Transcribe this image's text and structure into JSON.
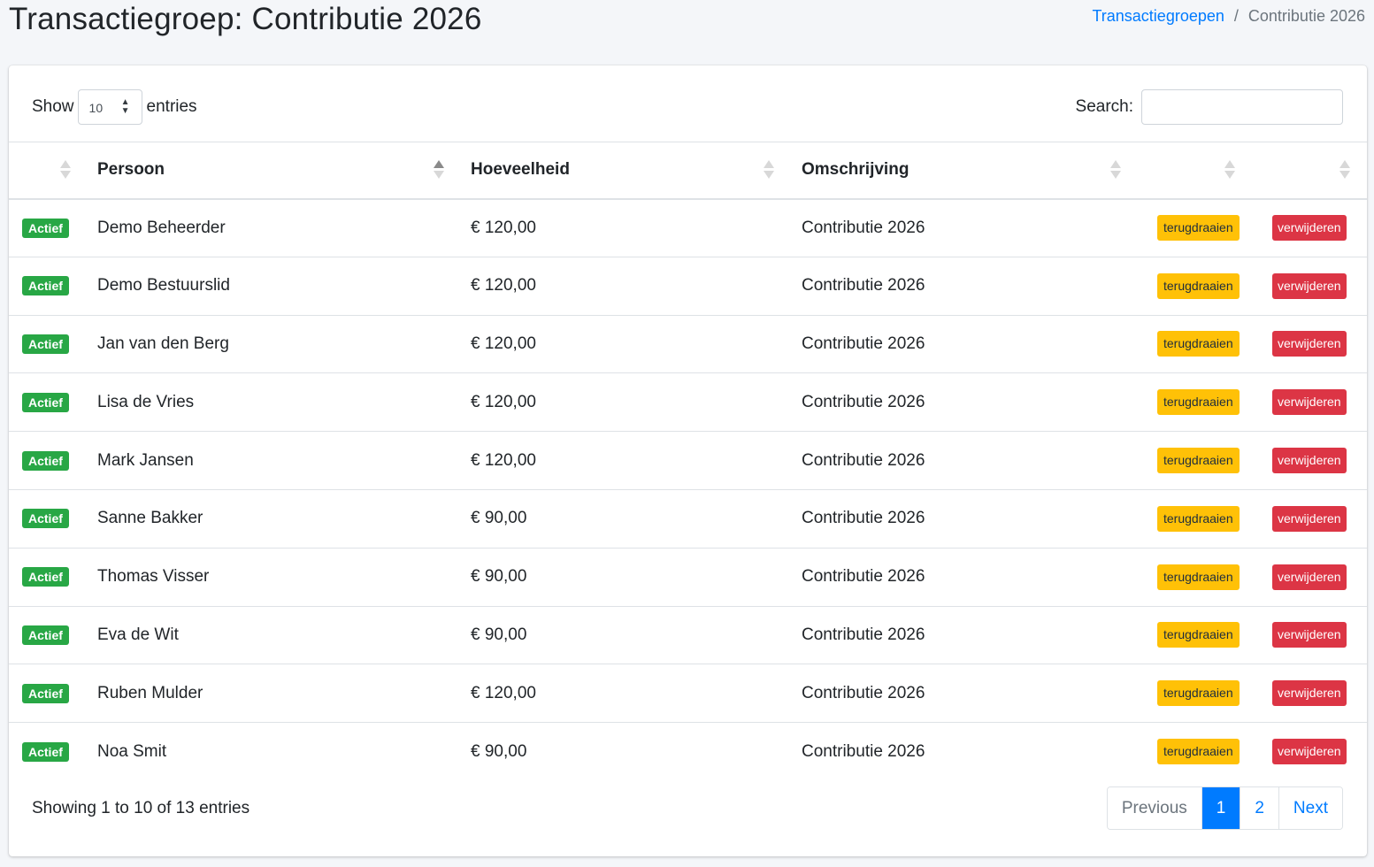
{
  "page": {
    "title": "Transactiegroep: Contributie 2026"
  },
  "breadcrumb": {
    "parent": "Transactiegroepen",
    "separator": "/",
    "current": "Contributie 2026"
  },
  "controls": {
    "show_label": "Show",
    "length_value": "10",
    "entries_label": "entries",
    "search_label": "Search:",
    "search_value": ""
  },
  "table": {
    "headers": [
      "",
      "Persoon",
      "Hoeveelheid",
      "Omschrijving",
      "",
      ""
    ],
    "sorted_column": "Persoon",
    "sort_direction": "asc",
    "rows": [
      {
        "status": "Actief",
        "persoon": "Demo Beheerder",
        "hoeveelheid": "€ 120,00",
        "omschrijving": "Contributie 2026",
        "revert": "terugdraaien",
        "delete": "verwijderen"
      },
      {
        "status": "Actief",
        "persoon": "Demo Bestuurslid",
        "hoeveelheid": "€ 120,00",
        "omschrijving": "Contributie 2026",
        "revert": "terugdraaien",
        "delete": "verwijderen"
      },
      {
        "status": "Actief",
        "persoon": "Jan van den Berg",
        "hoeveelheid": "€ 120,00",
        "omschrijving": "Contributie 2026",
        "revert": "terugdraaien",
        "delete": "verwijderen"
      },
      {
        "status": "Actief",
        "persoon": "Lisa de Vries",
        "hoeveelheid": "€ 120,00",
        "omschrijving": "Contributie 2026",
        "revert": "terugdraaien",
        "delete": "verwijderen"
      },
      {
        "status": "Actief",
        "persoon": "Mark Jansen",
        "hoeveelheid": "€ 120,00",
        "omschrijving": "Contributie 2026",
        "revert": "terugdraaien",
        "delete": "verwijderen"
      },
      {
        "status": "Actief",
        "persoon": "Sanne Bakker",
        "hoeveelheid": "€ 90,00",
        "omschrijving": "Contributie 2026",
        "revert": "terugdraaien",
        "delete": "verwijderen"
      },
      {
        "status": "Actief",
        "persoon": "Thomas Visser",
        "hoeveelheid": "€ 90,00",
        "omschrijving": "Contributie 2026",
        "revert": "terugdraaien",
        "delete": "verwijderen"
      },
      {
        "status": "Actief",
        "persoon": "Eva de Wit",
        "hoeveelheid": "€ 90,00",
        "omschrijving": "Contributie 2026",
        "revert": "terugdraaien",
        "delete": "verwijderen"
      },
      {
        "status": "Actief",
        "persoon": "Ruben Mulder",
        "hoeveelheid": "€ 120,00",
        "omschrijving": "Contributie 2026",
        "revert": "terugdraaien",
        "delete": "verwijderen"
      },
      {
        "status": "Actief",
        "persoon": "Noa Smit",
        "hoeveelheid": "€ 90,00",
        "omschrijving": "Contributie 2026",
        "revert": "terugdraaien",
        "delete": "verwijderen"
      }
    ]
  },
  "footer": {
    "info": "Showing 1 to 10 of 13 entries"
  },
  "pagination": {
    "previous": "Previous",
    "pages": [
      "1",
      "2"
    ],
    "active_page": "1",
    "next": "Next"
  },
  "colors": {
    "primary": "#007bff",
    "success": "#28a745",
    "warning": "#ffc107",
    "danger": "#dc3545"
  }
}
